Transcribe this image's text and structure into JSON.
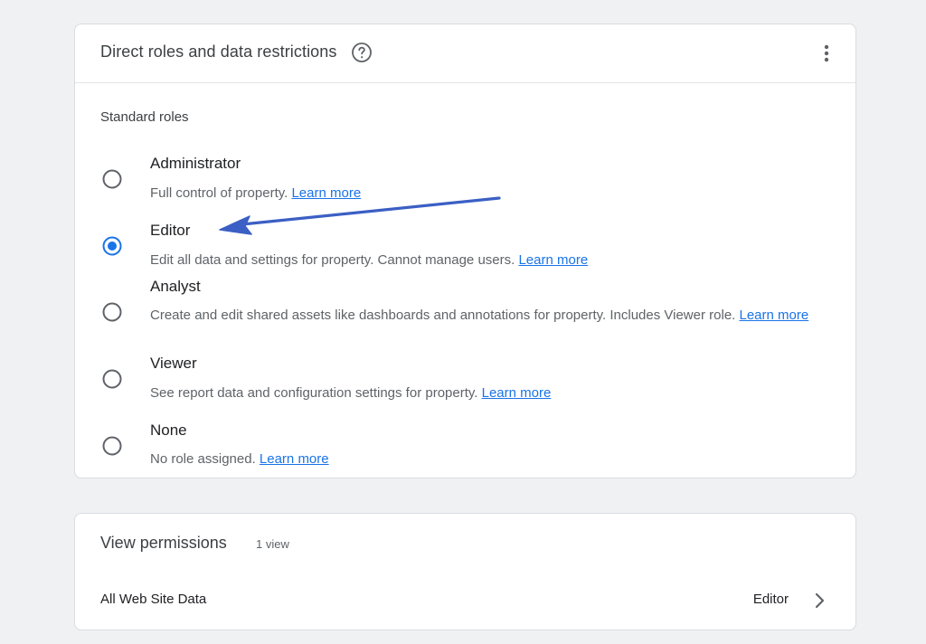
{
  "roles_card": {
    "title": "Direct roles and data restrictions",
    "help_icon": "help-circle-icon",
    "menu_icon": "more-vert-icon",
    "section_label": "Standard roles",
    "selected_role": "Editor",
    "roles": [
      {
        "name": "Administrator",
        "description": "Full control of property. ",
        "link": "Learn more",
        "selected": false
      },
      {
        "name": "Editor",
        "description": "Edit all data and settings for property. Cannot manage users. ",
        "link": "Learn more",
        "selected": true
      },
      {
        "name": "Analyst",
        "description": "Create and edit shared assets like dashboards and annotations for property. Includes Viewer role. ",
        "link": "Learn more",
        "selected": false
      },
      {
        "name": "Viewer",
        "description": "See report data and configuration settings for property. ",
        "link": "Learn more",
        "selected": false
      },
      {
        "name": "None",
        "description": "No role assigned. ",
        "link": "Learn more",
        "selected": false
      }
    ]
  },
  "views_card": {
    "title": "View permissions",
    "count": "1 view",
    "rows": [
      {
        "name": "All Web Site Data",
        "role": "Editor",
        "icon": "chevron-right-icon"
      }
    ]
  },
  "annotation": {
    "type": "arrow",
    "points_to": "Editor",
    "color": "#3b5fc4"
  },
  "colors": {
    "accent": "#1a73e8",
    "background": "#f0f1f3",
    "card": "#ffffff"
  }
}
